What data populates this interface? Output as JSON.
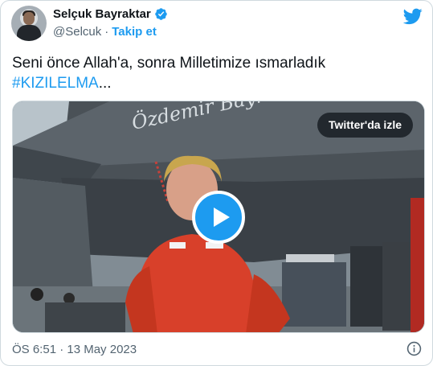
{
  "author": {
    "name": "Selçuk Bayraktar",
    "handle": "@Selcuk",
    "separator": "·",
    "follow_label": "Takip et"
  },
  "tweet": {
    "text": "Seni önce Allah'a, sonra Milletimize ısmarladık",
    "hashtag": "#KIZILELMA",
    "ellipsis": "..."
  },
  "media": {
    "watch_label": "Twitter'da izle",
    "aircraft_signature": "Özdemir Bayraktar"
  },
  "timestamp": "ÖS 6:51 · 13 May 2023",
  "icons": {
    "verified": "verified-badge-icon",
    "logo": "twitter-bird-icon",
    "play": "play-icon",
    "info": "info-icon"
  },
  "colors": {
    "accent": "#1d9bf0",
    "text": "#0f1419",
    "secondary": "#536471",
    "border": "#cfd9de"
  }
}
